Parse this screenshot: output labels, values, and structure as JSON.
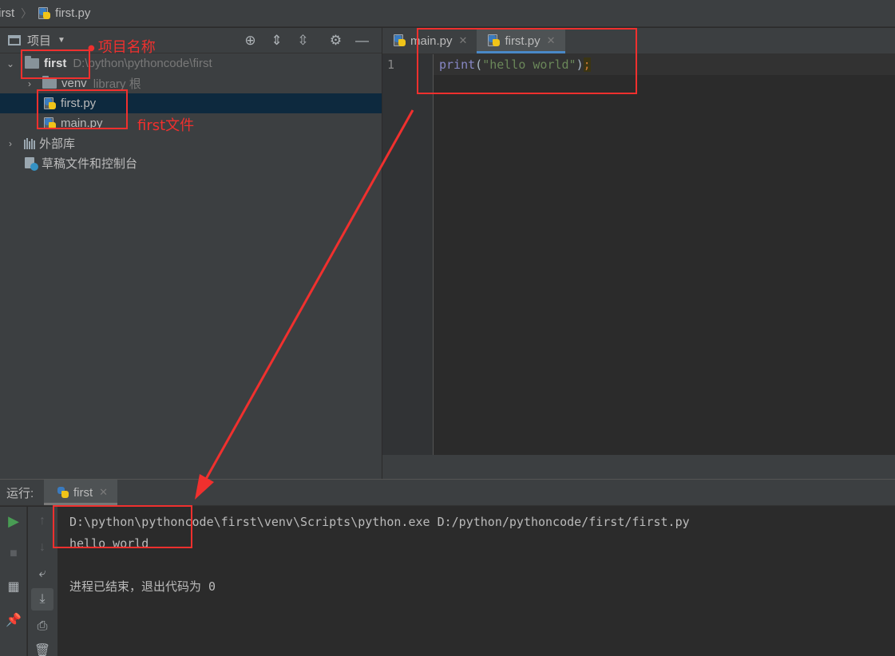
{
  "titlebar": {
    "project": "first",
    "file": "first.py"
  },
  "project_panel": {
    "title": "项目",
    "tools": [
      "locate-icon",
      "expand-all-icon",
      "collapse-all-icon",
      "gear-icon",
      "minimize-icon"
    ],
    "tree": {
      "root": {
        "name": "first",
        "path": "D:\\python\\pythoncode\\first"
      },
      "venv": {
        "name": "venv",
        "hint": "library 根"
      },
      "files": [
        "first.py",
        "main.py"
      ],
      "external_libs": "外部库",
      "scratches": "草稿文件和控制台"
    }
  },
  "editor": {
    "tabs": [
      {
        "label": "main.py",
        "active": false
      },
      {
        "label": "first.py",
        "active": true
      }
    ],
    "line_number": "1",
    "code": {
      "fn": "print",
      "open": "(",
      "str": "\"hello world\"",
      "close": ")",
      "semi": ";"
    }
  },
  "run_panel": {
    "label": "运行:",
    "tab": "first",
    "console": [
      "D:\\python\\pythoncode\\first\\venv\\Scripts\\python.exe D:/python/pythoncode/first/first.py",
      "hello world",
      "",
      "进程已结束，退出代码为 0"
    ]
  },
  "annotations": {
    "project_name": "项目名称",
    "first_file": "first文件",
    "color": "#f0302e"
  }
}
